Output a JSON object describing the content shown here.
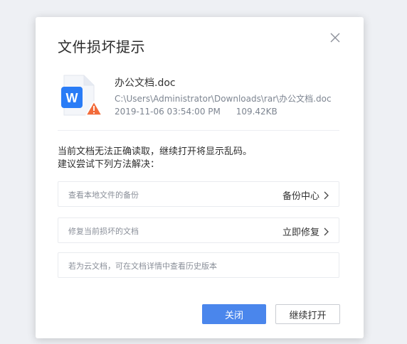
{
  "dialog": {
    "title": "文件损坏提示",
    "close_icon": "close-icon"
  },
  "file": {
    "icon": "word-document-warning-icon",
    "icon_letter": "W",
    "name": "办公文档.doc",
    "path": "C:\\Users\\Administrator\\Downloads\\rar\\办公文档.doc",
    "datetime": "2019-11-06  03:54:00 PM",
    "size": "109.42KB"
  },
  "message": {
    "line1": "当前文档无法正确读取，继续打开将显示乱码。",
    "line2": "建议尝试下列方法解决："
  },
  "options": [
    {
      "label": "查看本地文件的备份",
      "action": "备份中心"
    },
    {
      "label": "修复当前损坏的文档",
      "action": "立即修复"
    },
    {
      "label": "若为云文档，可在文档详情中查看历史版本"
    }
  ],
  "buttons": {
    "close": "关闭",
    "continue_open": "继续打开"
  },
  "colors": {
    "accent": "#4a86ec",
    "word_blue": "#2a7cf6",
    "warning_orange": "#f26b3a"
  }
}
